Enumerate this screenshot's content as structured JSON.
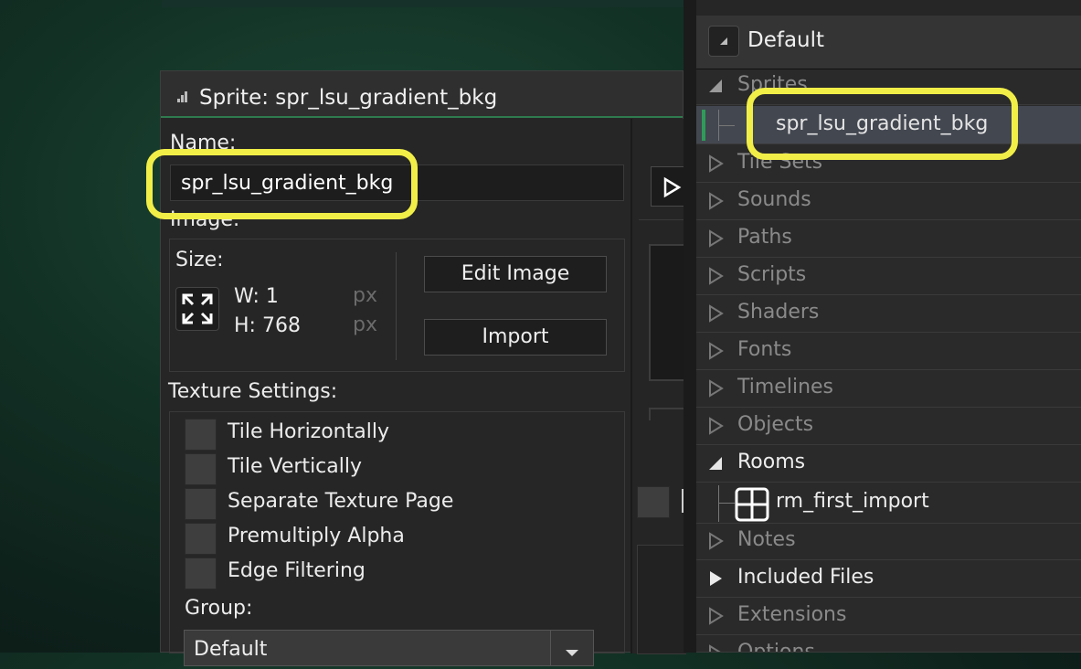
{
  "sprite_window": {
    "title": "Sprite: spr_lsu_gradient_bkg",
    "name_label": "Name:",
    "name_value": "spr_lsu_gradient_bkg",
    "image_label": "Image:",
    "size_label": "Size:",
    "width_text": "W: 1",
    "height_text": "H: 768",
    "unit": "px",
    "edit_image_label": "Edit Image",
    "import_label": "Import",
    "texture_settings_label": "Texture Settings:",
    "texture_options": [
      {
        "label": "Tile Horizontally",
        "checked": false
      },
      {
        "label": "Tile Vertically",
        "checked": false
      },
      {
        "label": "Separate Texture Page",
        "checked": false
      },
      {
        "label": "Premultiply Alpha",
        "checked": false
      },
      {
        "label": "Edge Filtering",
        "checked": false
      }
    ],
    "group_label": "Group:",
    "group_value": "Default"
  },
  "resource_tree": {
    "config": "Default",
    "items": [
      {
        "label": "Sprites",
        "state": "expanded"
      },
      {
        "label": "spr_lsu_gradient_bkg",
        "state": "child-selected"
      },
      {
        "label": "Tile Sets",
        "state": "empty"
      },
      {
        "label": "Sounds",
        "state": "empty"
      },
      {
        "label": "Paths",
        "state": "empty"
      },
      {
        "label": "Scripts",
        "state": "empty"
      },
      {
        "label": "Shaders",
        "state": "empty"
      },
      {
        "label": "Fonts",
        "state": "empty"
      },
      {
        "label": "Timelines",
        "state": "empty"
      },
      {
        "label": "Objects",
        "state": "empty"
      },
      {
        "label": "Rooms",
        "state": "expanded"
      },
      {
        "label": "rm_first_import",
        "state": "child"
      },
      {
        "label": "Notes",
        "state": "empty"
      },
      {
        "label": "Included Files",
        "state": "collapsed"
      },
      {
        "label": "Extensions",
        "state": "empty"
      },
      {
        "label": "Options",
        "state": "empty"
      }
    ]
  },
  "colors": {
    "highlight": "#f1ee48",
    "accent_green": "#2f7a4f",
    "selection": "#434750"
  }
}
